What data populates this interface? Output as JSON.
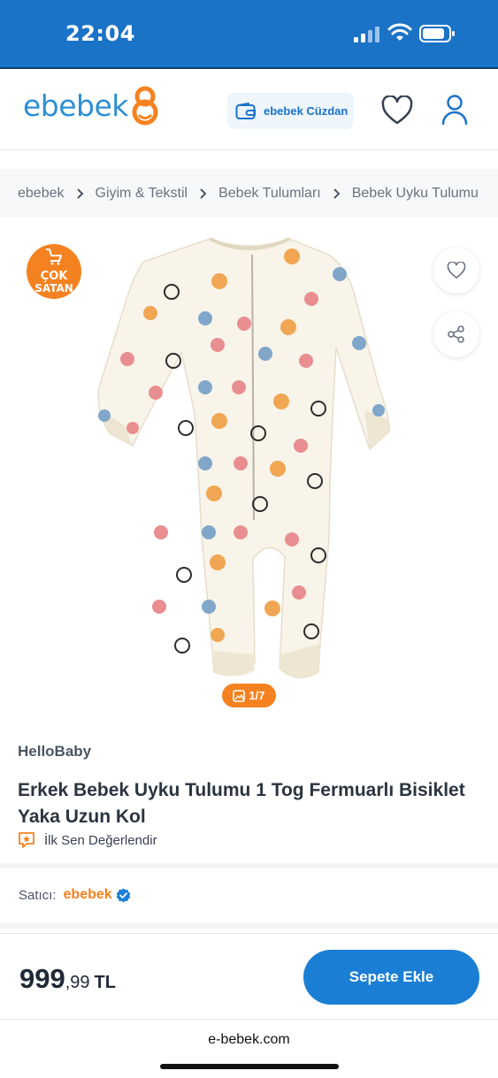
{
  "status_bar": {
    "time": "22:04"
  },
  "header": {
    "logo_text": "ebebek",
    "wallet_label": "ebebek Cüzdan"
  },
  "breadcrumb": [
    "ebebek",
    "Giyim & Tekstil",
    "Bebek Tulumları",
    "Bebek Uyku Tulumu"
  ],
  "gallery": {
    "badge_lines": [
      "ÇOK",
      "SATAN"
    ],
    "image_index": "1/7",
    "accent_color": "#f58220"
  },
  "product": {
    "brand": "HelloBaby",
    "title": "Erkek Bebek Uyku Tulumu 1 Tog Fermuarlı Bisiklet Yaka Uzun Kol",
    "review_cta": "İlk Sen Değerlendir"
  },
  "seller": {
    "label": "Satıcı:",
    "name": "ebebek"
  },
  "buy_bar": {
    "price_int": "999",
    "price_dec": ",99",
    "currency": "TL",
    "add_to_cart": "Sepete Ekle",
    "button_color": "#1a7fd4"
  },
  "browser": {
    "url": "e-bebek.com"
  }
}
